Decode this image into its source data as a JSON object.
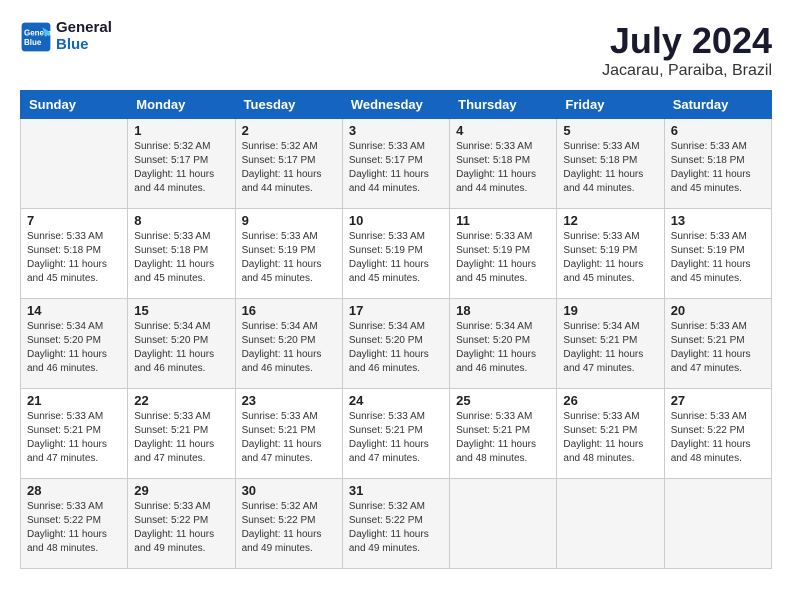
{
  "header": {
    "logo_line1": "General",
    "logo_line2": "Blue",
    "month": "July 2024",
    "location": "Jacarau, Paraiba, Brazil"
  },
  "days_of_week": [
    "Sunday",
    "Monday",
    "Tuesday",
    "Wednesday",
    "Thursday",
    "Friday",
    "Saturday"
  ],
  "weeks": [
    [
      {
        "day": "",
        "info": ""
      },
      {
        "day": "1",
        "info": "Sunrise: 5:32 AM\nSunset: 5:17 PM\nDaylight: 11 hours\nand 44 minutes."
      },
      {
        "day": "2",
        "info": "Sunrise: 5:32 AM\nSunset: 5:17 PM\nDaylight: 11 hours\nand 44 minutes."
      },
      {
        "day": "3",
        "info": "Sunrise: 5:33 AM\nSunset: 5:17 PM\nDaylight: 11 hours\nand 44 minutes."
      },
      {
        "day": "4",
        "info": "Sunrise: 5:33 AM\nSunset: 5:18 PM\nDaylight: 11 hours\nand 44 minutes."
      },
      {
        "day": "5",
        "info": "Sunrise: 5:33 AM\nSunset: 5:18 PM\nDaylight: 11 hours\nand 44 minutes."
      },
      {
        "day": "6",
        "info": "Sunrise: 5:33 AM\nSunset: 5:18 PM\nDaylight: 11 hours\nand 45 minutes."
      }
    ],
    [
      {
        "day": "7",
        "info": "Sunrise: 5:33 AM\nSunset: 5:18 PM\nDaylight: 11 hours\nand 45 minutes."
      },
      {
        "day": "8",
        "info": "Sunrise: 5:33 AM\nSunset: 5:18 PM\nDaylight: 11 hours\nand 45 minutes."
      },
      {
        "day": "9",
        "info": "Sunrise: 5:33 AM\nSunset: 5:19 PM\nDaylight: 11 hours\nand 45 minutes."
      },
      {
        "day": "10",
        "info": "Sunrise: 5:33 AM\nSunset: 5:19 PM\nDaylight: 11 hours\nand 45 minutes."
      },
      {
        "day": "11",
        "info": "Sunrise: 5:33 AM\nSunset: 5:19 PM\nDaylight: 11 hours\nand 45 minutes."
      },
      {
        "day": "12",
        "info": "Sunrise: 5:33 AM\nSunset: 5:19 PM\nDaylight: 11 hours\nand 45 minutes."
      },
      {
        "day": "13",
        "info": "Sunrise: 5:33 AM\nSunset: 5:19 PM\nDaylight: 11 hours\nand 45 minutes."
      }
    ],
    [
      {
        "day": "14",
        "info": "Sunrise: 5:34 AM\nSunset: 5:20 PM\nDaylight: 11 hours\nand 46 minutes."
      },
      {
        "day": "15",
        "info": "Sunrise: 5:34 AM\nSunset: 5:20 PM\nDaylight: 11 hours\nand 46 minutes."
      },
      {
        "day": "16",
        "info": "Sunrise: 5:34 AM\nSunset: 5:20 PM\nDaylight: 11 hours\nand 46 minutes."
      },
      {
        "day": "17",
        "info": "Sunrise: 5:34 AM\nSunset: 5:20 PM\nDaylight: 11 hours\nand 46 minutes."
      },
      {
        "day": "18",
        "info": "Sunrise: 5:34 AM\nSunset: 5:20 PM\nDaylight: 11 hours\nand 46 minutes."
      },
      {
        "day": "19",
        "info": "Sunrise: 5:34 AM\nSunset: 5:21 PM\nDaylight: 11 hours\nand 47 minutes."
      },
      {
        "day": "20",
        "info": "Sunrise: 5:33 AM\nSunset: 5:21 PM\nDaylight: 11 hours\nand 47 minutes."
      }
    ],
    [
      {
        "day": "21",
        "info": "Sunrise: 5:33 AM\nSunset: 5:21 PM\nDaylight: 11 hours\nand 47 minutes."
      },
      {
        "day": "22",
        "info": "Sunrise: 5:33 AM\nSunset: 5:21 PM\nDaylight: 11 hours\nand 47 minutes."
      },
      {
        "day": "23",
        "info": "Sunrise: 5:33 AM\nSunset: 5:21 PM\nDaylight: 11 hours\nand 47 minutes."
      },
      {
        "day": "24",
        "info": "Sunrise: 5:33 AM\nSunset: 5:21 PM\nDaylight: 11 hours\nand 47 minutes."
      },
      {
        "day": "25",
        "info": "Sunrise: 5:33 AM\nSunset: 5:21 PM\nDaylight: 11 hours\nand 48 minutes."
      },
      {
        "day": "26",
        "info": "Sunrise: 5:33 AM\nSunset: 5:21 PM\nDaylight: 11 hours\nand 48 minutes."
      },
      {
        "day": "27",
        "info": "Sunrise: 5:33 AM\nSunset: 5:22 PM\nDaylight: 11 hours\nand 48 minutes."
      }
    ],
    [
      {
        "day": "28",
        "info": "Sunrise: 5:33 AM\nSunset: 5:22 PM\nDaylight: 11 hours\nand 48 minutes."
      },
      {
        "day": "29",
        "info": "Sunrise: 5:33 AM\nSunset: 5:22 PM\nDaylight: 11 hours\nand 49 minutes."
      },
      {
        "day": "30",
        "info": "Sunrise: 5:32 AM\nSunset: 5:22 PM\nDaylight: 11 hours\nand 49 minutes."
      },
      {
        "day": "31",
        "info": "Sunrise: 5:32 AM\nSunset: 5:22 PM\nDaylight: 11 hours\nand 49 minutes."
      },
      {
        "day": "",
        "info": ""
      },
      {
        "day": "",
        "info": ""
      },
      {
        "day": "",
        "info": ""
      }
    ]
  ]
}
